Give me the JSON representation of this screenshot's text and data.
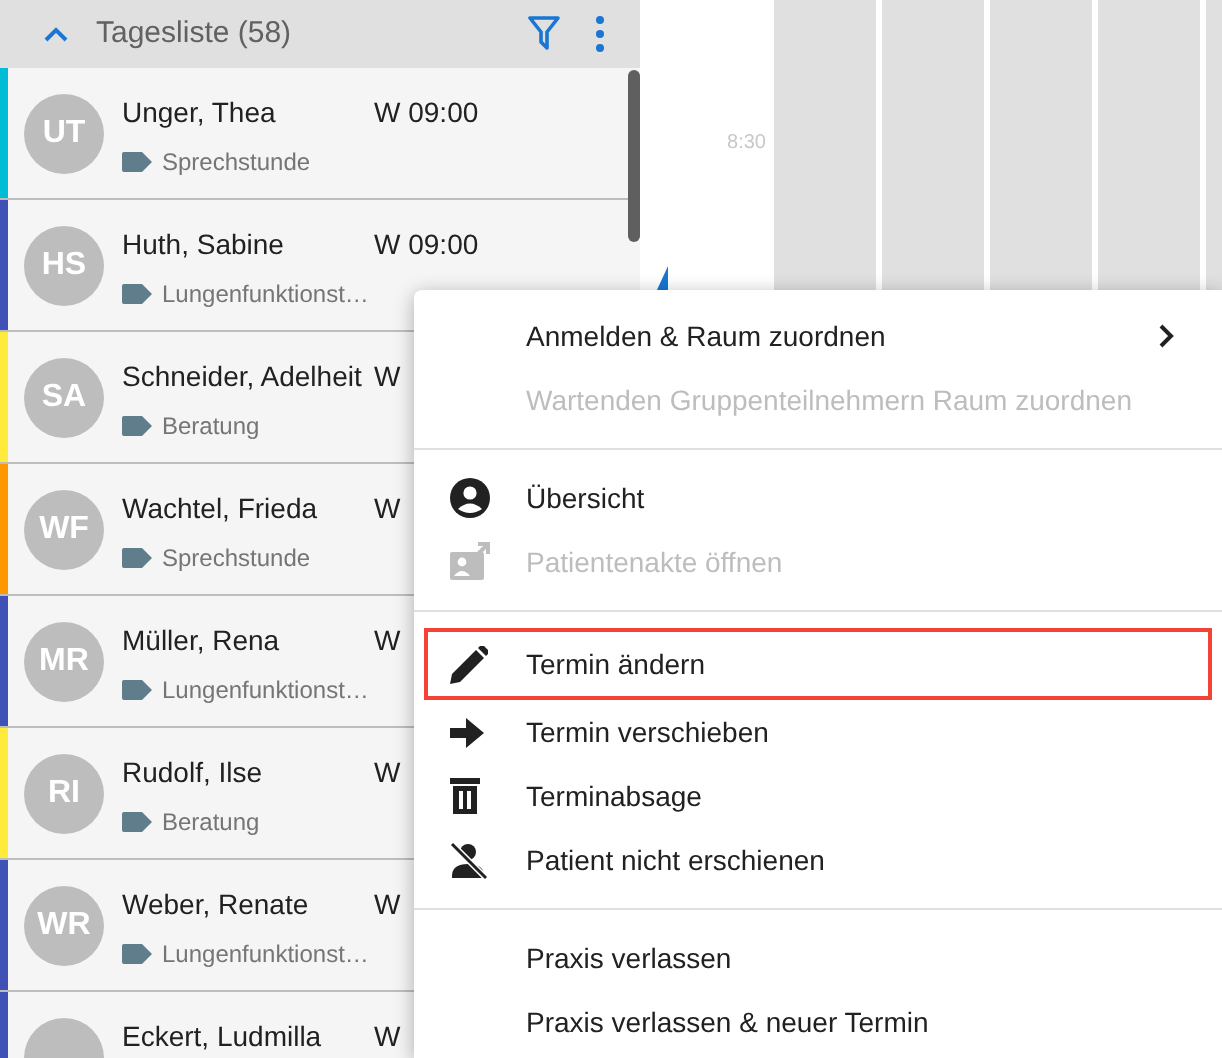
{
  "day_list": {
    "title": "Tagesliste (58)",
    "expanded": true,
    "rows": [
      {
        "initials": "UT",
        "name": "Unger, Thea",
        "time": "W 09:00",
        "type": "Sprechstunde",
        "color": "#00bcd4"
      },
      {
        "initials": "HS",
        "name": "Huth, Sabine",
        "time": "W 09:00",
        "type": "Lungenfunktionst…",
        "color": "#3f51b5"
      },
      {
        "initials": "SA",
        "name": "Schneider, Adelheit",
        "time": "W",
        "type": "Beratung",
        "color": "#ffeb3b"
      },
      {
        "initials": "WF",
        "name": "Wachtel, Frieda",
        "time": "W",
        "type": "Sprechstunde",
        "color": "#ff9800"
      },
      {
        "initials": "MR",
        "name": "Müller, Rena",
        "time": "W",
        "type": "Lungenfunktionst…",
        "color": "#3f51b5"
      },
      {
        "initials": "RI",
        "name": "Rudolf, Ilse",
        "time": "W",
        "type": "Beratung",
        "color": "#ffeb3b"
      },
      {
        "initials": "WR",
        "name": "Weber, Renate",
        "time": "W",
        "type": "Lungenfunktionst…",
        "color": "#3f51b5"
      },
      {
        "name": "Eckert, Ludmilla",
        "time": "W",
        "color": "#3f51b5"
      }
    ]
  },
  "calendar": {
    "time_label": "8:30"
  },
  "context_menu": {
    "groups": [
      {
        "items": [
          {
            "label": "Anmelden & Raum zuordnen",
            "disabled": false,
            "highlighted": false,
            "has_submenu": true
          },
          {
            "label": "Wartenden Gruppenteilnehmern Raum zuordnen",
            "disabled": true,
            "highlighted": false,
            "has_submenu": false
          }
        ]
      },
      {
        "items": [
          {
            "label": "Übersicht",
            "disabled": false,
            "highlighted": false,
            "has_submenu": false
          },
          {
            "label": "Patientenakte öffnen",
            "disabled": true,
            "highlighted": false,
            "has_submenu": false
          }
        ]
      },
      {
        "items": [
          {
            "label": "Termin ändern",
            "disabled": false,
            "highlighted": true,
            "has_submenu": false
          },
          {
            "label": "Termin verschieben",
            "disabled": false,
            "highlighted": false,
            "has_submenu": false
          },
          {
            "label": "Terminabsage",
            "disabled": false,
            "highlighted": false,
            "has_submenu": false
          },
          {
            "label": "Patient nicht erschienen",
            "disabled": false,
            "highlighted": false,
            "has_submenu": false
          }
        ]
      },
      {
        "items": [
          {
            "label": "Praxis verlassen",
            "disabled": false,
            "highlighted": false,
            "has_submenu": false
          },
          {
            "label": "Praxis verlassen & neuer Termin",
            "disabled": false,
            "highlighted": false,
            "has_submenu": false
          }
        ]
      }
    ]
  }
}
